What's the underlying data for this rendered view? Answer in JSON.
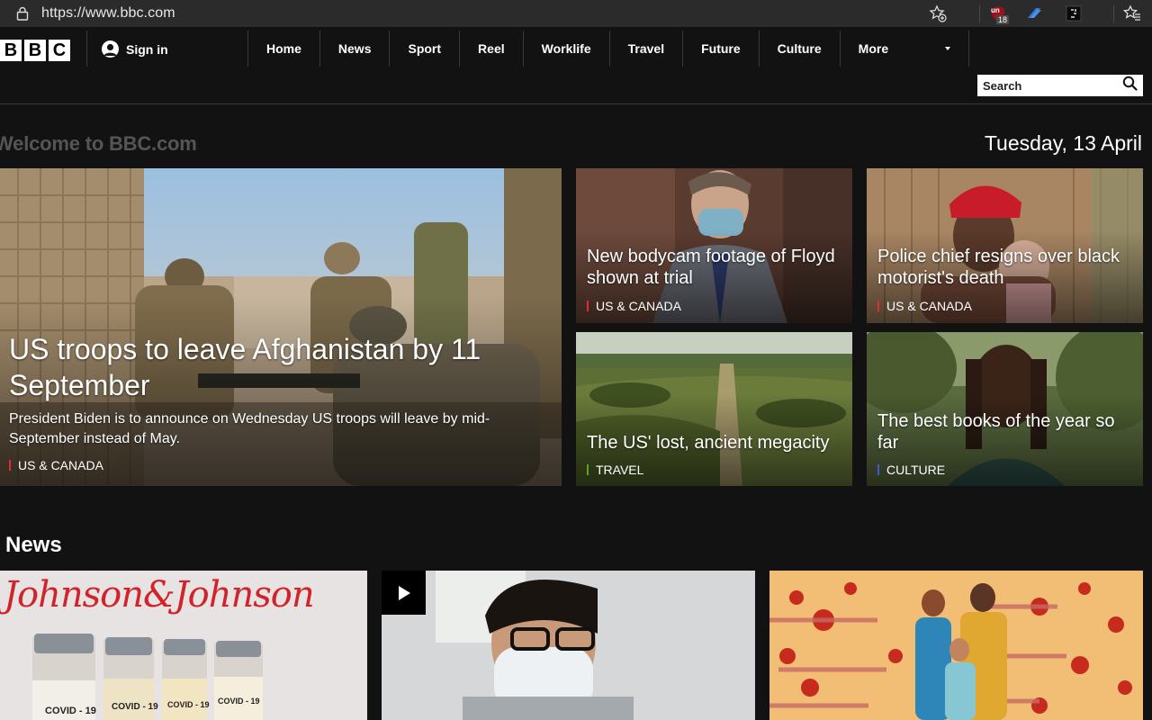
{
  "browser": {
    "url": "https://www.bbc.com",
    "ext_badge": "18",
    "ext_label": "un"
  },
  "header": {
    "logo_letters": [
      "B",
      "B",
      "C"
    ],
    "signin": "Sign in",
    "nav": [
      "Home",
      "News",
      "Sport",
      "Reel",
      "Worklife",
      "Travel",
      "Future",
      "Culture"
    ],
    "more": "More",
    "search_placeholder": "Search"
  },
  "welcome": "Welcome to BBC.com",
  "date": "Tuesday, 13 April",
  "hero": {
    "main": {
      "headline": "US troops to leave Afghanistan by 11 September",
      "summary": "President Biden is to announce on Wednesday US troops will leave by mid-September instead of May.",
      "tag": "US & CANADA",
      "tag_color": "#e52b2b"
    },
    "cards": [
      {
        "headline": "New bodycam footage of Floyd shown at trial",
        "tag": "US & CANADA",
        "tag_color": "#e52b2b"
      },
      {
        "headline": "Police chief resigns over black motorist's death",
        "tag": "US & CANADA",
        "tag_color": "#e52b2b"
      },
      {
        "headline": "The US' lost, ancient megacity",
        "tag": "TRAVEL",
        "tag_color": "#5aa02c"
      },
      {
        "headline": "The best books of the year so far",
        "tag": "CULTURE",
        "tag_color": "#3a5bd6"
      }
    ]
  },
  "news": {
    "title": "News",
    "jj_text": "Johnson&Johnson",
    "vial_label": "COVID - 19"
  },
  "colors": {
    "background": "#121212",
    "us_canada": "#e52b2b",
    "travel": "#5aa02c",
    "culture": "#3a5bd6"
  }
}
